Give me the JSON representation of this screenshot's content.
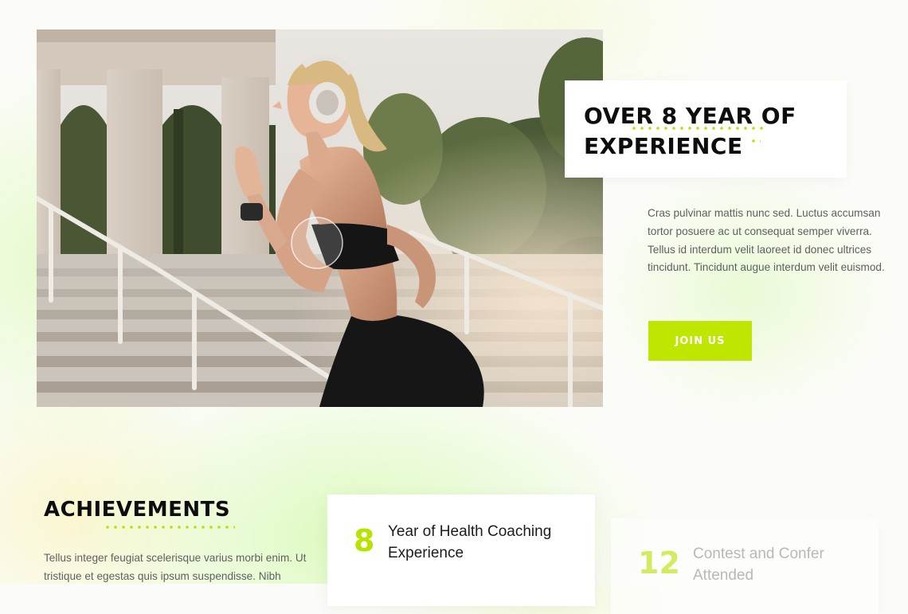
{
  "hero": {
    "image_alt": "Woman running up stadium stairs wearing headphones"
  },
  "experience": {
    "title_line1": "OVER 8 YEAR OF",
    "title_line2": "EXPERIENCE",
    "description": "Cras pulvinar mattis nunc sed. Luctus accumsan tortor posuere ac ut consequat semper viverra. Tellus id interdum velit laoreet id donec ultrices tincidunt. Tincidunt augue interdum velit euismod.",
    "cta_label": "JOIN US"
  },
  "achievements": {
    "title": "ACHIEVEMENTS",
    "text": "Tellus integer feugiat scelerisque varius morbi enim. Ut tristique et egestas quis ipsum suspendisse. Nibh"
  },
  "stats": [
    {
      "number": "8",
      "label": "Year of Health Coaching Experience"
    },
    {
      "number": "12",
      "label": "Contest and Confer Attended"
    }
  ],
  "colors": {
    "accent": "#bfe600",
    "heading": "#0d0d0d",
    "body_text": "#5f5f5f"
  }
}
